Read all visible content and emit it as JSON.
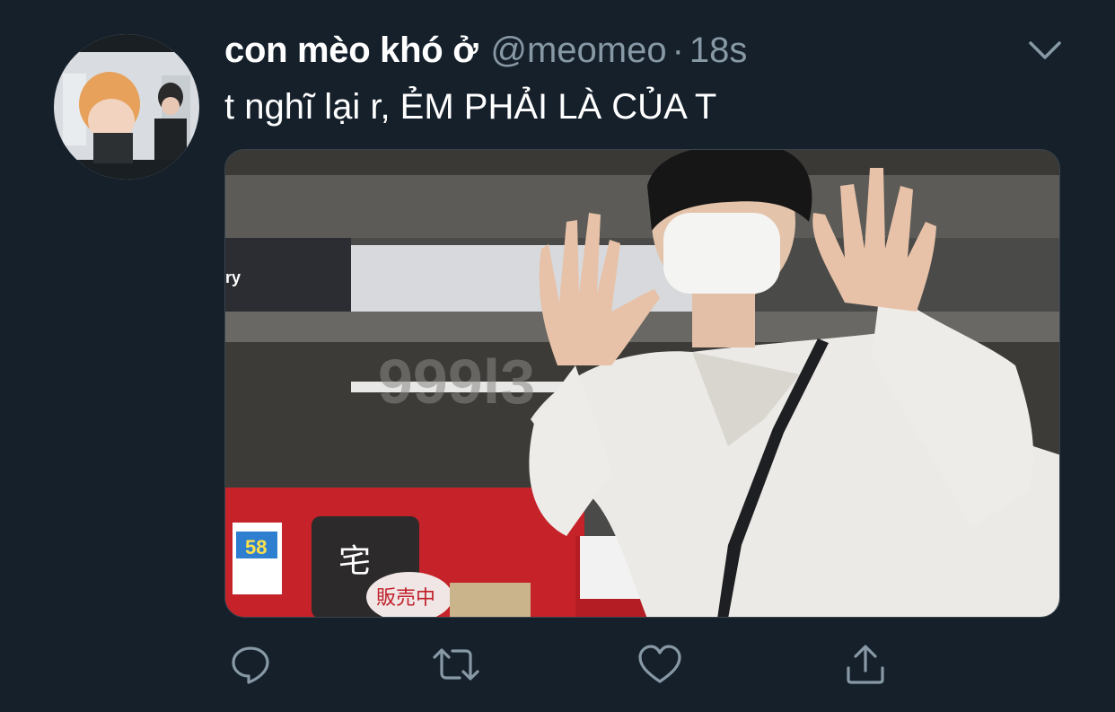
{
  "tweet": {
    "display_name": "con mèo khó ở",
    "handle": "@meomeo",
    "separator": "·",
    "time": "18s",
    "text": "t nghĩ lại r, ẺM PHẢI LÀ CỦA T"
  },
  "avatar": {
    "description_icon": "profile-avatar"
  },
  "media": {
    "watermark": "999l3",
    "sign_fragment": "ry",
    "price_tag": "58",
    "kanji_1": "宅",
    "kanji_2": "販売中"
  },
  "actions": {
    "reply_icon": "reply-icon",
    "retweet_icon": "retweet-icon",
    "like_icon": "heart-icon",
    "share_icon": "share-icon"
  },
  "colors": {
    "background": "#15202b",
    "secondary_text": "#8899a6",
    "primary_text": "#ffffff"
  }
}
